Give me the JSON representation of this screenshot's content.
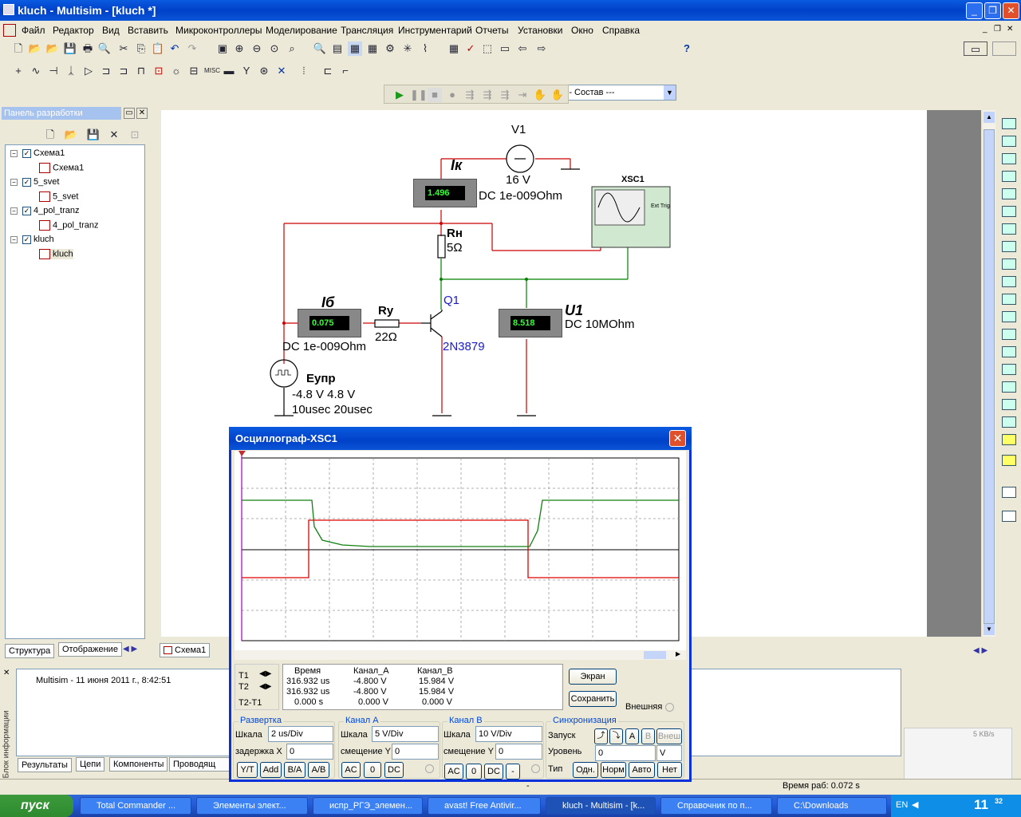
{
  "window": {
    "title": "kluch - Multisim - [kluch *]",
    "min": "_",
    "max": "❐",
    "close": "✕"
  },
  "menu": [
    "Файл",
    "Редактор",
    "Вид",
    "Вставить",
    "Микроконтроллеры",
    "Моделирование",
    "Трансляция",
    "Инструментарий",
    "Отчеты",
    "Установки",
    "Окно",
    "Справка"
  ],
  "toolbar": {
    "combo_value": "--- Состав ---"
  },
  "panel": {
    "title": "Панель разработки",
    "close": "✕",
    "tree": [
      {
        "label": "Схема1",
        "child": "Схема1"
      },
      {
        "label": "5_svet",
        "child": "5_svet"
      },
      {
        "label": "4_pol_tranz",
        "child": "4_pol_tranz"
      },
      {
        "label": "kluch",
        "child": "kluch"
      }
    ],
    "tabs": [
      "Структура",
      "Отображение"
    ]
  },
  "sheet_tab": "Схема1",
  "circuit": {
    "v1_name": "V1",
    "v1_value": "16 V",
    "ik_label": "Iк",
    "ik_reading": "1.496",
    "ik_cfg": "DC  1e-009Ohm",
    "xsc_name": "XSC1",
    "xsc_ext": "Ext Trig",
    "rn_name": "Rн",
    "rn_value": "5Ω",
    "q1_name": "Q1",
    "q1_model": "2N3879",
    "ib_label": "Iб",
    "ib_reading": "0.075",
    "ib_cfg": "DC  1e-009Ohm",
    "ry_name": "Ry",
    "ry_value": "22Ω",
    "u1_label": "U1",
    "u1_reading": "8.518",
    "u1_cfg": "DC  10MOhm",
    "eupr_name": "Eупр",
    "eupr_v": "-4.8 V 4.8 V",
    "eupr_t": "10usec 20usec"
  },
  "osc": {
    "title": "Осциллограф-XSC1",
    "close": "✕",
    "meas_header": [
      "Время",
      "Канал_A",
      "Канал_B"
    ],
    "rows": [
      {
        "label": "T1",
        "time": "316.932 us",
        "a": "-4.800 V",
        "b": "15.984 V"
      },
      {
        "label": "T2",
        "time": "316.932 us",
        "a": "-4.800 V",
        "b": "15.984 V"
      },
      {
        "label": "T2-T1",
        "time": "0.000 s",
        "a": "0.000 V",
        "b": "0.000 V"
      }
    ],
    "btn_screen": "Экран",
    "btn_save": "Сохранить",
    "ext": "Внешняя",
    "sweep": {
      "title": "Развертка",
      "scale_lbl": "Шкала",
      "scale": "2 us/Div",
      "delay_lbl": "задержка X",
      "delay": "0",
      "btns": [
        "Y/T",
        "Add",
        "B/A",
        "A/B"
      ]
    },
    "cha": {
      "title": "Канал A",
      "scale_lbl": "Шкала",
      "scale": "5  V/Div",
      "off_lbl": "смещение Y",
      "off": "0",
      "btns": [
        "AC",
        "0",
        "DC"
      ]
    },
    "chb": {
      "title": "Канал B",
      "scale_lbl": "Шкала",
      "scale": "10  V/Div",
      "off_lbl": "смещение Y",
      "off": "0",
      "btns": [
        "AC",
        "0",
        "DC",
        "-"
      ]
    },
    "sync": {
      "title": "Синхронизация",
      "start_lbl": "Запуск",
      "level_lbl": "Уровень",
      "level": "0",
      "unit": "V",
      "type_lbl": "Тип",
      "edge_btns": [
        "A",
        "B",
        "Внеш"
      ],
      "type_btns": [
        "Одн.",
        "Норм",
        "Авто",
        "Нет"
      ]
    }
  },
  "info": {
    "text": "Multisim  -  11 июня 2011 г., 8:42:51",
    "side": "Блок информации",
    "tabs": [
      "Результаты",
      "Цепи",
      "Компоненты",
      "Проводящ"
    ]
  },
  "status": {
    "dash": "-",
    "runtime": "Время раб: 0.072 s"
  },
  "net_widget": "5 KB/s",
  "taskbar": {
    "start": "пуск",
    "tasks": [
      "Total Commander ...",
      "Элементы элект...",
      "испр_РГЭ_элемен...",
      "avast! Free Antivir...",
      "kluch - Multisim - [k...",
      "Справочник по п...",
      "C:\\Downloads"
    ],
    "lang": "EN",
    "clock": "11",
    "clock_min": "32"
  },
  "colors": {
    "wire_red": "#cc0000",
    "wire_green": "#008000",
    "trace_red": "#e00000",
    "trace_green": "#108010",
    "title_blue": "#0a5be0"
  }
}
